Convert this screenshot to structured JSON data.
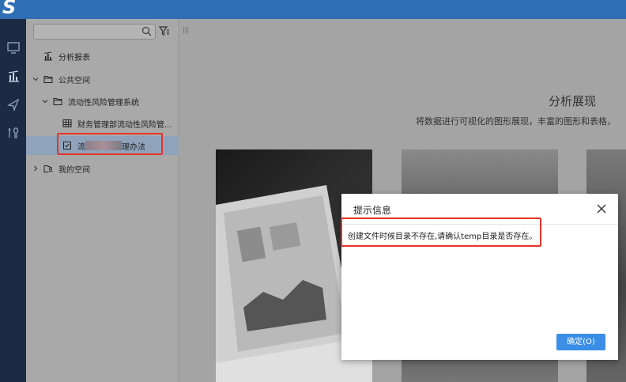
{
  "app": {
    "logo_text": "S"
  },
  "leftnav": {
    "items": [
      {
        "icon": "monitor-icon"
      },
      {
        "icon": "report-chart-icon"
      },
      {
        "icon": "send-icon"
      },
      {
        "icon": "tools-icon"
      }
    ]
  },
  "tree": {
    "search_placeholder": "",
    "items": [
      {
        "label": "分析报表",
        "icon": "report-chart-icon"
      },
      {
        "label": "公共空间",
        "icon": "folder-icon"
      },
      {
        "label": "流动性风险管理系统",
        "icon": "folder-icon"
      },
      {
        "label": "财务管理部流动性风险管...",
        "icon": "table-icon"
      },
      {
        "label_prefix": "流",
        "label_suffix": "理办法",
        "icon": "document-icon"
      },
      {
        "label": "我的空间",
        "icon": "folder-user-icon"
      }
    ]
  },
  "content": {
    "title": "分析展现",
    "subtitle": "将数据进行可视化的图形展现，丰富的图形和表格，"
  },
  "dialog": {
    "title": "提示信息",
    "message": "创建文件时候目录不存在,请确认temp目录是否存在。",
    "ok_label": "确定(O)"
  },
  "colors": {
    "topbar": "#2f6fb6",
    "leftnav": "#1c2a44",
    "highlight": "#e8332a",
    "ok_button": "#3a8ee6"
  }
}
